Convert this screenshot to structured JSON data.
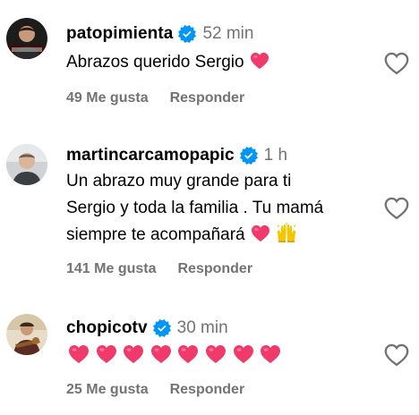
{
  "comments": [
    {
      "username": "patopimienta",
      "time": "52 min",
      "text_line1": "Abrazos querido Sergio",
      "likes": "49 Me gusta",
      "reply": "Responder"
    },
    {
      "username": "martincarcamopapic",
      "time": "1 h",
      "text_line1": "Un abrazo muy grande para ti",
      "text_line2": "Sergio y toda la familia . Tu mamá",
      "text_line3": "siempre te acompañará",
      "likes": "141 Me gusta",
      "reply": "Responder"
    },
    {
      "username": "chopicotv",
      "time": "30 min",
      "heart_emoji_count": 8,
      "likes": "25 Me gusta",
      "reply": "Responder"
    }
  ],
  "icons": {
    "verified": "verified-badge-icon",
    "like": "heart-outline-icon",
    "emoji_heart": "pink-heart-emoji-icon",
    "emoji_hands": "raising-hands-emoji-icon"
  },
  "colors": {
    "verified_blue": "#0095f6",
    "secondary_text": "#737373",
    "emoji_heart": "#f03a6b"
  }
}
